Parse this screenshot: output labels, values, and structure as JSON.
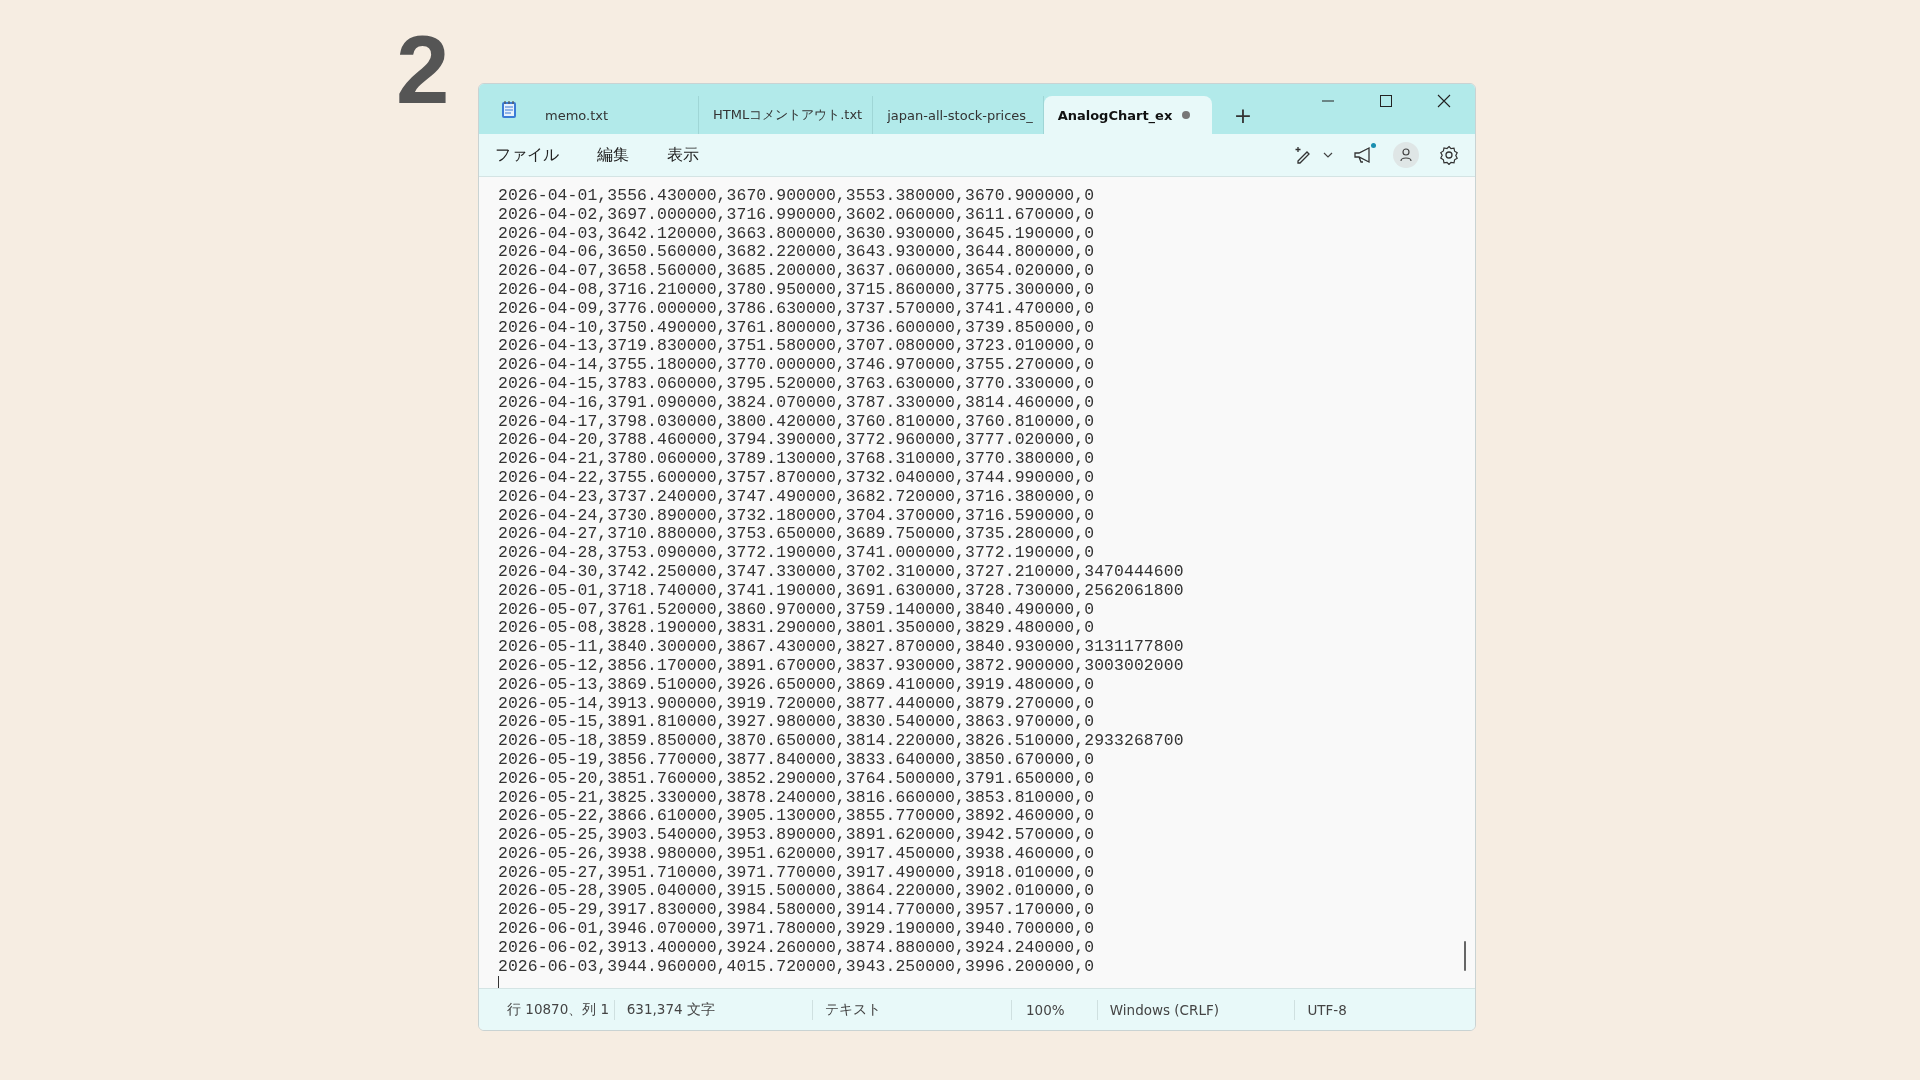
{
  "step_number": "2",
  "tabs": [
    {
      "label": "memo.txt",
      "selected": false,
      "modified": false
    },
    {
      "label": "HTMLコメントアウト.txt",
      "selected": false,
      "modified": false
    },
    {
      "label": "japan-all-stock-prices_",
      "selected": false,
      "modified": false
    },
    {
      "label": "AnalogChart_ex",
      "selected": true,
      "modified": true
    }
  ],
  "new_tab": "+",
  "menu": [
    "ファイル",
    "編集",
    "表示"
  ],
  "notification_dot": true,
  "lines": [
    "2026-04-01,3556.430000,3670.900000,3553.380000,3670.900000,0",
    "2026-04-02,3697.000000,3716.990000,3602.060000,3611.670000,0",
    "2026-04-03,3642.120000,3663.800000,3630.930000,3645.190000,0",
    "2026-04-06,3650.560000,3682.220000,3643.930000,3644.800000,0",
    "2026-04-07,3658.560000,3685.200000,3637.060000,3654.020000,0",
    "2026-04-08,3716.210000,3780.950000,3715.860000,3775.300000,0",
    "2026-04-09,3776.000000,3786.630000,3737.570000,3741.470000,0",
    "2026-04-10,3750.490000,3761.800000,3736.600000,3739.850000,0",
    "2026-04-13,3719.830000,3751.580000,3707.080000,3723.010000,0",
    "2026-04-14,3755.180000,3770.000000,3746.970000,3755.270000,0",
    "2026-04-15,3783.060000,3795.520000,3763.630000,3770.330000,0",
    "2026-04-16,3791.090000,3824.070000,3787.330000,3814.460000,0",
    "2026-04-17,3798.030000,3800.420000,3760.810000,3760.810000,0",
    "2026-04-20,3788.460000,3794.390000,3772.960000,3777.020000,0",
    "2026-04-21,3780.060000,3789.130000,3768.310000,3770.380000,0",
    "2026-04-22,3755.600000,3757.870000,3732.040000,3744.990000,0",
    "2026-04-23,3737.240000,3747.490000,3682.720000,3716.380000,0",
    "2026-04-24,3730.890000,3732.180000,3704.370000,3716.590000,0",
    "2026-04-27,3710.880000,3753.650000,3689.750000,3735.280000,0",
    "2026-04-28,3753.090000,3772.190000,3741.000000,3772.190000,0",
    "2026-04-30,3742.250000,3747.330000,3702.310000,3727.210000,3470444600",
    "2026-05-01,3718.740000,3741.190000,3691.630000,3728.730000,2562061800",
    "2026-05-07,3761.520000,3860.970000,3759.140000,3840.490000,0",
    "2026-05-08,3828.190000,3831.290000,3801.350000,3829.480000,0",
    "2026-05-11,3840.300000,3867.430000,3827.870000,3840.930000,3131177800",
    "2026-05-12,3856.170000,3891.670000,3837.930000,3872.900000,3003002000",
    "2026-05-13,3869.510000,3926.650000,3869.410000,3919.480000,0",
    "2026-05-14,3913.900000,3919.720000,3877.440000,3879.270000,0",
    "2026-05-15,3891.810000,3927.980000,3830.540000,3863.970000,0",
    "2026-05-18,3859.850000,3870.650000,3814.220000,3826.510000,2933268700",
    "2026-05-19,3856.770000,3877.840000,3833.640000,3850.670000,0",
    "2026-05-20,3851.760000,3852.290000,3764.500000,3791.650000,0",
    "2026-05-21,3825.330000,3878.240000,3816.660000,3853.810000,0",
    "2026-05-22,3866.610000,3905.130000,3855.770000,3892.460000,0",
    "2026-05-25,3903.540000,3953.890000,3891.620000,3942.570000,0",
    "2026-05-26,3938.980000,3951.620000,3917.450000,3938.460000,0",
    "2026-05-27,3951.710000,3971.770000,3917.490000,3918.010000,0",
    "2026-05-28,3905.040000,3915.500000,3864.220000,3902.010000,0",
    "2026-05-29,3917.830000,3984.580000,3914.770000,3957.170000,0",
    "2026-06-01,3946.070000,3971.780000,3929.190000,3940.700000,0",
    "2026-06-02,3913.400000,3924.260000,3874.880000,3924.240000,0",
    "2026-06-03,3944.960000,4015.720000,3943.250000,3996.200000,0"
  ],
  "status_bar": [
    "行 10870、列 1",
    "631,374 文字",
    "テキスト",
    "100%",
    "Windows (CRLF)",
    "UTF-8"
  ]
}
